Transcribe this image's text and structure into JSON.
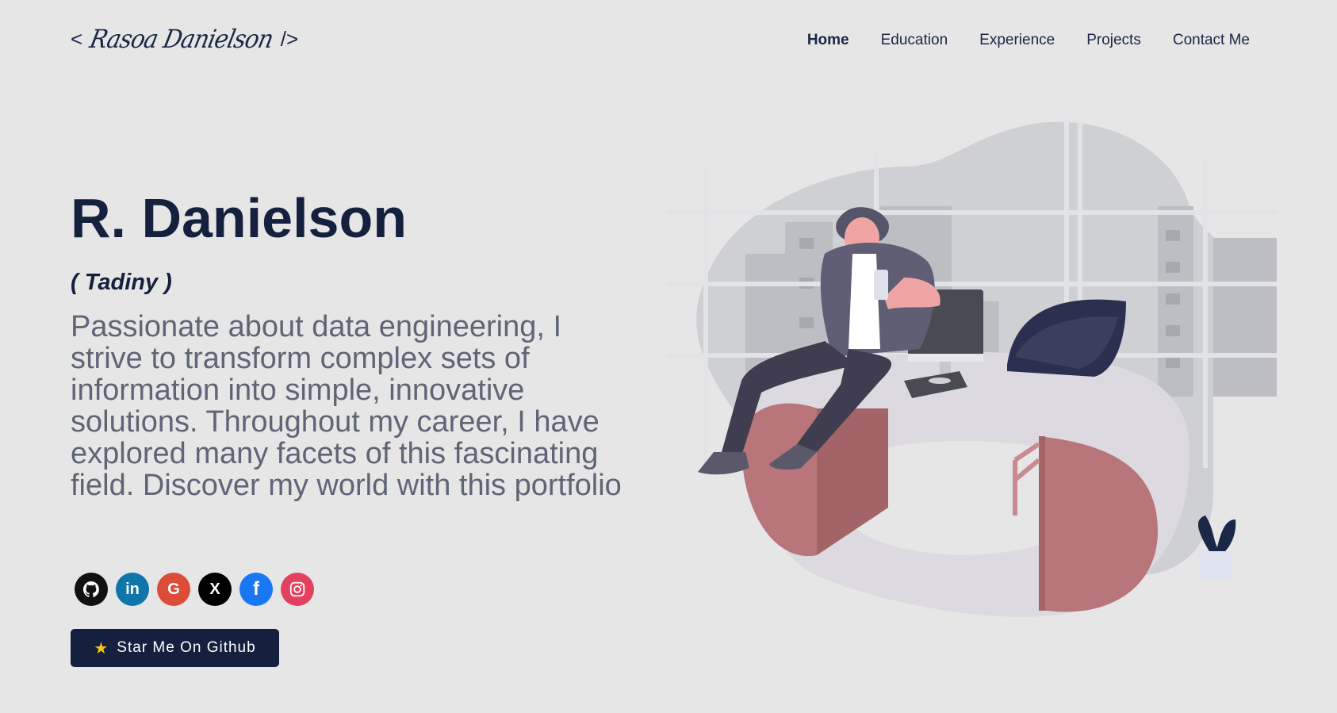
{
  "logo": {
    "open": "<",
    "name": "Rasoa Danielson",
    "close": "/>"
  },
  "nav": {
    "items": [
      {
        "label": "Home",
        "active": true
      },
      {
        "label": "Education",
        "active": false
      },
      {
        "label": "Experience",
        "active": false
      },
      {
        "label": "Projects",
        "active": false
      },
      {
        "label": "Contact Me",
        "active": false
      }
    ]
  },
  "hero": {
    "title": "R. Danielson",
    "subtitle": "( Tadiny )",
    "description": "Passionate about data engineering, I strive to transform complex sets of information into simple, innovative solutions. Throughout my career, I have explored many facets of this fascinating field. Discover my world with this portfolio"
  },
  "socials": [
    {
      "icon": "github-icon",
      "glyph": "⚉",
      "color": "#111111"
    },
    {
      "icon": "linkedin-icon",
      "glyph": "in",
      "color": "#0e76a8"
    },
    {
      "icon": "google-icon",
      "glyph": "G",
      "color": "#dd4b39"
    },
    {
      "icon": "x-icon",
      "glyph": "X",
      "color": "#000000"
    },
    {
      "icon": "facebook-icon",
      "glyph": "f",
      "color": "#1877f2"
    },
    {
      "icon": "instagram-icon",
      "glyph": "◎",
      "color": "#e4405f"
    }
  ],
  "cta": {
    "label": "Star Me On Github",
    "star": "★"
  },
  "colors": {
    "background": "#e6e6e6",
    "primary": "#14203d",
    "text_muted": "#5f6577",
    "desk_red": "#b8767a",
    "star": "#f5c518"
  }
}
